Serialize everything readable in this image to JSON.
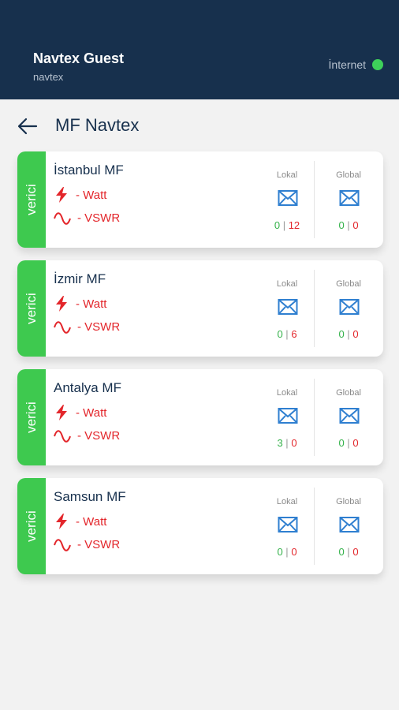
{
  "header": {
    "user_name": "Navtex Guest",
    "user_sub": "navtex",
    "internet_label": "İnternet",
    "status_color": "#3ed05a",
    "bg_color": "#17304d"
  },
  "titlebar": {
    "back_icon": "arrow-left-icon",
    "title": "MF Navtex"
  },
  "stations": [
    {
      "tag": "verici",
      "name": "İstanbul MF",
      "watt": "- Watt",
      "vswr": "- VSWR",
      "lokal_label": "Lokal",
      "lokal_ok": "0",
      "lokal_sep": "|",
      "lokal_err": "12",
      "global_label": "Global",
      "global_ok": "0",
      "global_sep": "|",
      "global_err": "0"
    },
    {
      "tag": "verici",
      "name": "İzmir MF",
      "watt": "- Watt",
      "vswr": "- VSWR",
      "lokal_label": "Lokal",
      "lokal_ok": "0",
      "lokal_sep": "|",
      "lokal_err": "6",
      "global_label": "Global",
      "global_ok": "0",
      "global_sep": "|",
      "global_err": "0"
    },
    {
      "tag": "verici",
      "name": "Antalya MF",
      "watt": "- Watt",
      "vswr": "- VSWR",
      "lokal_label": "Lokal",
      "lokal_ok": "3",
      "lokal_sep": "|",
      "lokal_err": "0",
      "global_label": "Global",
      "global_ok": "0",
      "global_sep": "|",
      "global_err": "0"
    },
    {
      "tag": "verici",
      "name": "Samsun MF",
      "watt": "- Watt",
      "vswr": "- VSWR",
      "lokal_label": "Lokal",
      "lokal_ok": "0",
      "lokal_sep": "|",
      "lokal_err": "0",
      "global_label": "Global",
      "global_ok": "0",
      "global_sep": "|",
      "global_err": "0"
    }
  ],
  "icons": {
    "power": "lightning-bolt-icon",
    "wave": "sine-wave-icon",
    "message": "envelope-icon"
  },
  "colors": {
    "strip": "#3ec94f",
    "ok": "#35b24b",
    "err": "#e3262b",
    "mail": "#2f7fd0"
  }
}
